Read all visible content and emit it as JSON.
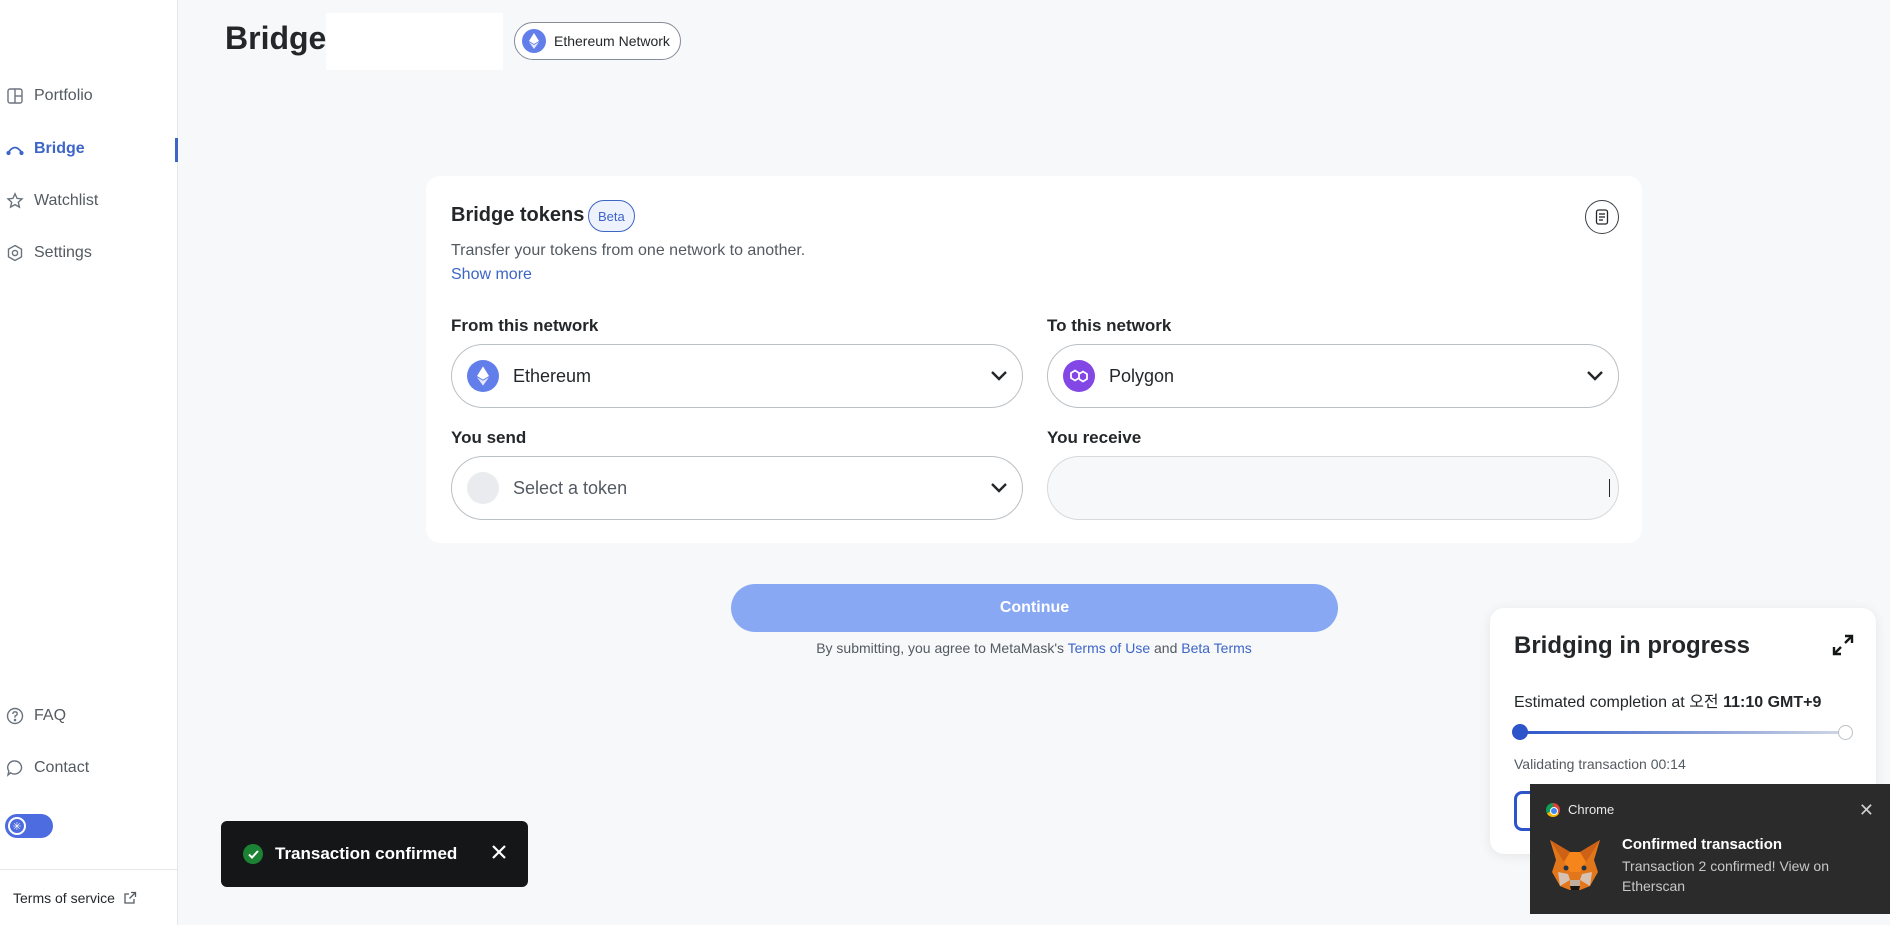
{
  "sidebar": {
    "items": [
      {
        "label": "Portfolio",
        "icon": "portfolio-icon"
      },
      {
        "label": "Bridge",
        "icon": "bridge-icon",
        "active": true
      },
      {
        "label": "Watchlist",
        "icon": "star-icon"
      },
      {
        "label": "Settings",
        "icon": "gear-icon"
      }
    ],
    "bottom_items": [
      {
        "label": "FAQ",
        "icon": "help-icon"
      },
      {
        "label": "Contact",
        "icon": "chat-icon"
      }
    ],
    "terms": "Terms of service"
  },
  "header": {
    "title": "Bridge",
    "network": "Ethereum Network"
  },
  "card": {
    "title": "Bridge tokens",
    "badge": "Beta",
    "description": "Transfer your tokens from one network to another.",
    "show_more": "Show more",
    "from_label": "From this network",
    "from_value": "Ethereum",
    "to_label": "To this network",
    "to_value": "Polygon",
    "send_label": "You send",
    "send_placeholder": "Select a token",
    "receive_label": "You receive"
  },
  "footer": {
    "continue": "Continue",
    "agree_prefix": "By submitting, you agree to MetaMask's",
    "terms_of_use": "Terms of Use",
    "and": "and",
    "beta_terms": "Beta Terms"
  },
  "bridging": {
    "title": "Bridging in progress",
    "estimate_prefix": "Estimated completion at 오전",
    "estimate_time": "11:10 GMT+9",
    "status": "Validating transaction 00:14",
    "progress": 0.0
  },
  "toast": {
    "message": "Transaction confirmed"
  },
  "notification": {
    "app": "Chrome",
    "title": "Confirmed transaction",
    "body": "Transaction 2 confirmed! View on Etherscan"
  },
  "colors": {
    "accent": "#3d65c7",
    "continue_disabled": "#89a8f3",
    "ethereum": "#627eea",
    "polygon": "#8247e5",
    "toast_bg": "#141618",
    "success": "#1c8234"
  }
}
